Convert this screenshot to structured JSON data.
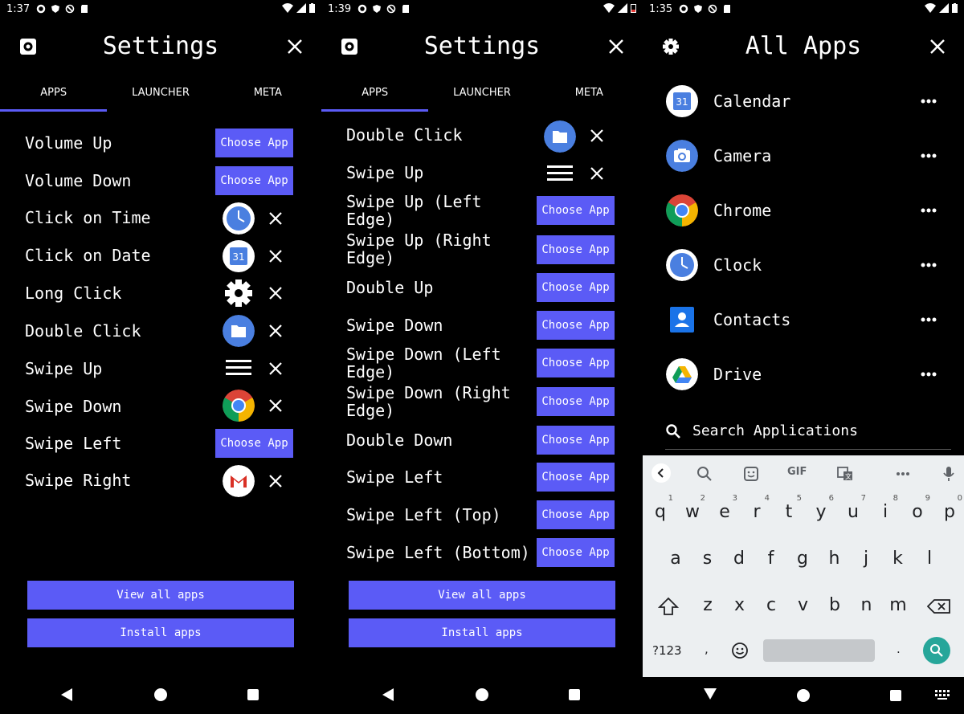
{
  "screen1": {
    "status_time": "1:37",
    "title": "Settings",
    "tabs": [
      "APPS",
      "LAUNCHER",
      "META"
    ],
    "rows": [
      {
        "label": "Volume Up",
        "button": "Choose App"
      },
      {
        "label": "Volume Down",
        "button": "Choose App"
      },
      {
        "label": "Click on Time",
        "icon": "clock-app-icon"
      },
      {
        "label": "Click on Date",
        "icon": "calendar-app-icon"
      },
      {
        "label": "Long Click",
        "icon": "settings-gear-icon"
      },
      {
        "label": "Double Click",
        "icon": "files-app-icon"
      },
      {
        "label": "Swipe Up",
        "icon": "menu-lines-icon"
      },
      {
        "label": "Swipe Down",
        "icon": "chrome-app-icon"
      },
      {
        "label": "Swipe Left",
        "button": "Choose App"
      },
      {
        "label": "Swipe Right",
        "icon": "gmail-app-icon"
      }
    ],
    "calendar_day": "31",
    "view_all_label": "View all apps",
    "install_label": "Install apps"
  },
  "screen2": {
    "status_time": "1:39",
    "title": "Settings",
    "tabs": [
      "APPS",
      "LAUNCHER",
      "META"
    ],
    "rows": [
      {
        "label": "Double Click",
        "icon": "files-app-icon"
      },
      {
        "label": "Swipe Up",
        "icon": "menu-lines-icon"
      },
      {
        "label": "Swipe Up (Left",
        "label2": "Edge)",
        "button": "Choose App"
      },
      {
        "label": "Swipe Up (Right",
        "label2": "Edge)",
        "button": "Choose App"
      },
      {
        "label": "Double Up",
        "button": "Choose App"
      },
      {
        "label": "Swipe Down",
        "button": "Choose App"
      },
      {
        "label": "Swipe Down (Left",
        "label2": "Edge)",
        "button": "Choose App"
      },
      {
        "label": "Swipe Down (Right",
        "label2": "Edge)",
        "button": "Choose App"
      },
      {
        "label": "Double Down",
        "button": "Choose App"
      },
      {
        "label": "Swipe Left",
        "button": "Choose App"
      },
      {
        "label": "Swipe Left (Top)",
        "button": "Choose App"
      },
      {
        "label": "Swipe Left (Bottom)",
        "button": "Choose App"
      }
    ],
    "view_all_label": "View all apps",
    "install_label": "Install apps"
  },
  "screen3": {
    "status_time": "1:35",
    "title": "All Apps",
    "apps": [
      {
        "name": "Calendar",
        "icon": "calendar-app-icon"
      },
      {
        "name": "Camera",
        "icon": "camera-app-icon"
      },
      {
        "name": "Chrome",
        "icon": "chrome-app-icon"
      },
      {
        "name": "Clock",
        "icon": "clock-app-icon"
      },
      {
        "name": "Contacts",
        "icon": "contacts-app-icon"
      },
      {
        "name": "Drive",
        "icon": "drive-app-icon"
      }
    ],
    "calendar_day": "31",
    "search_placeholder": "Search Applications",
    "keyboard": {
      "row1": [
        {
          "k": "q",
          "h": "1"
        },
        {
          "k": "w",
          "h": "2"
        },
        {
          "k": "e",
          "h": "3"
        },
        {
          "k": "r",
          "h": "4"
        },
        {
          "k": "t",
          "h": "5"
        },
        {
          "k": "y",
          "h": "6"
        },
        {
          "k": "u",
          "h": "7"
        },
        {
          "k": "i",
          "h": "8"
        },
        {
          "k": "o",
          "h": "9"
        },
        {
          "k": "p",
          "h": "0"
        }
      ],
      "row2": [
        "a",
        "s",
        "d",
        "f",
        "g",
        "h",
        "j",
        "k",
        "l"
      ],
      "row3": [
        "z",
        "x",
        "c",
        "v",
        "b",
        "n",
        "m"
      ],
      "gif_label": "GIF",
      "symbols_label": "?123",
      "comma": ",",
      "period": "."
    }
  },
  "colors": {
    "accent": "#5b5bf6",
    "background": "#000000",
    "keyboard_bg": "#eceff1",
    "search_key": "#26a69a"
  }
}
